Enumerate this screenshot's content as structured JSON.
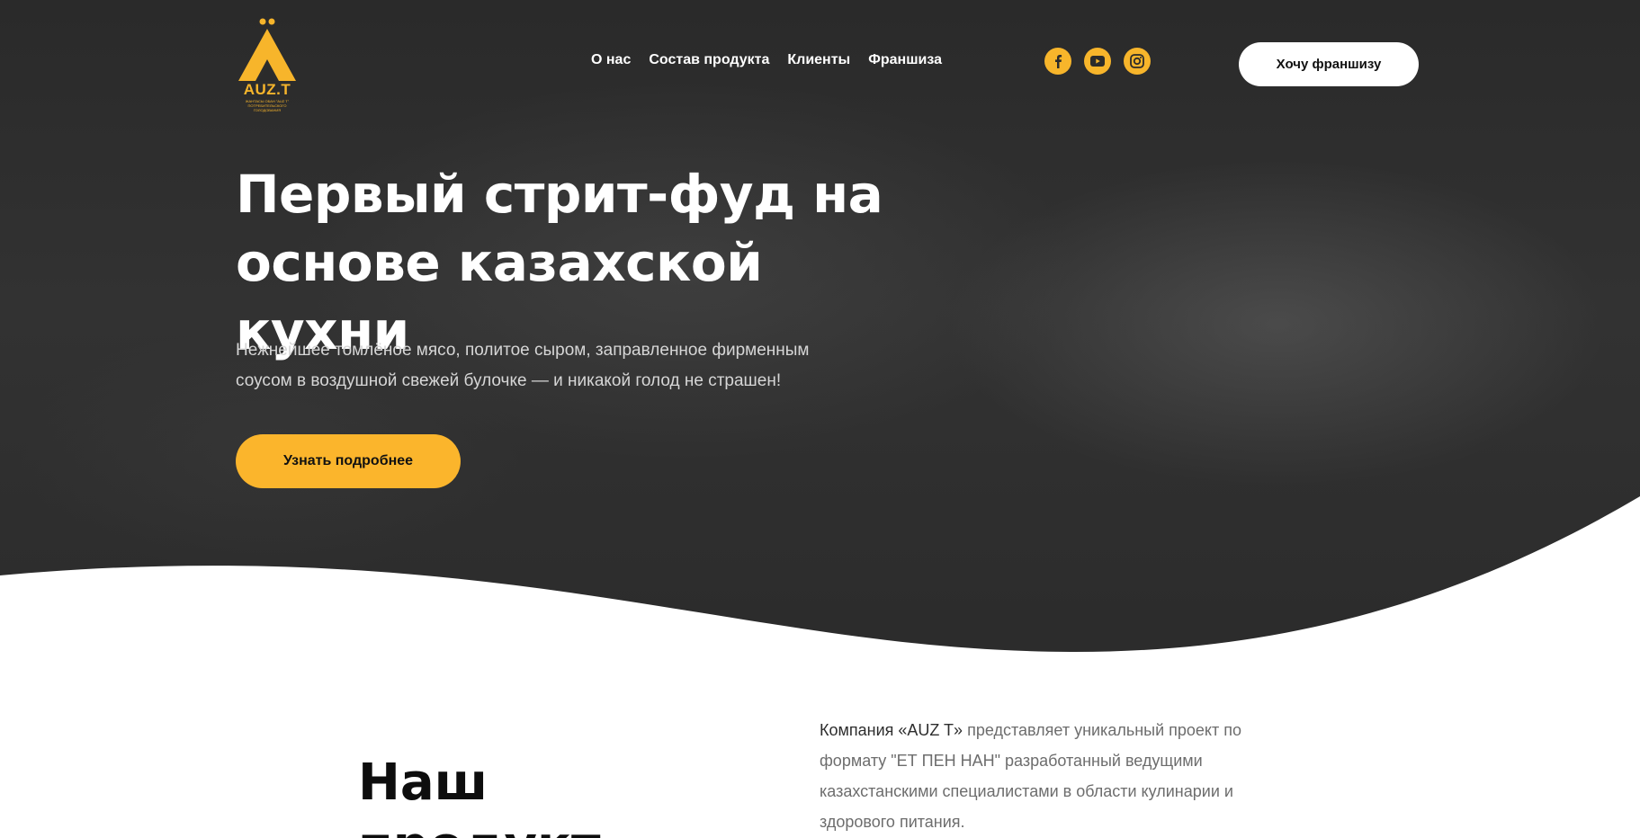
{
  "brand": {
    "logo_text": "AUZ.T",
    "logo_subtext": "ЖАНТАСЫ ОБАН \"AUZ T\" ПОТРЕБИТЕЛЬСКОГО ГОЛОДОВАНИЯ",
    "accent_color": "#f7b52b",
    "hero_bg_color": "#2f2f2f"
  },
  "nav": {
    "items": [
      {
        "label": "О нас"
      },
      {
        "label": "Состав продукта"
      },
      {
        "label": "Клиенты"
      },
      {
        "label": "Франшиза"
      }
    ]
  },
  "social": [
    {
      "icon": "facebook-icon"
    },
    {
      "icon": "youtube-icon"
    },
    {
      "icon": "instagram-icon"
    }
  ],
  "header": {
    "cta_label": "Хочу франшизу"
  },
  "hero": {
    "title_line1": "Первый стрит-фуд на",
    "title_line2": "основе казахской кухни",
    "desc_line1": "Нежнейшее томлёное мясо, политое сыром, заправленное фирменным",
    "desc_line2": "соусом в воздушной свежей булочке — и никакой голод не страшен!",
    "cta_label": "Узнать подробнее"
  },
  "product": {
    "title": "Наш продукт",
    "about_strong": "Компания «AUZ T»",
    "about_rest": " представляет уникальный проект по формату \"ЕТ ПЕН НАН\" разработанный ведущими казахстанскими специалистами в области кулинарии и здорового питания."
  }
}
